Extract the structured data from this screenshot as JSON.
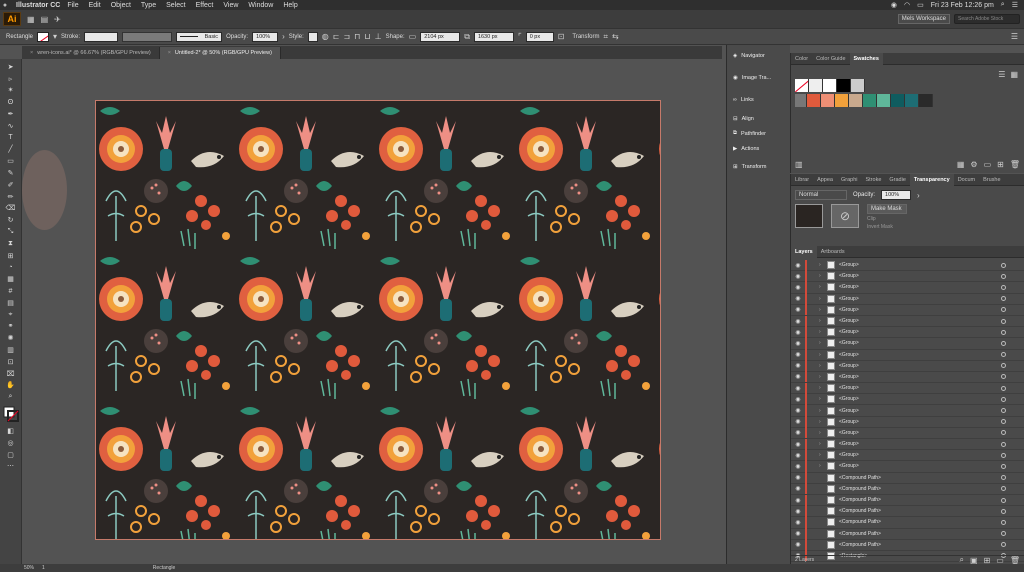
{
  "menubar": {
    "app_name": "Illustrator CC",
    "items": [
      "File",
      "Edit",
      "Object",
      "Type",
      "Select",
      "Effect",
      "View",
      "Window",
      "Help"
    ],
    "clock": "Fri 23 Feb 12:26 pm"
  },
  "appbar": {
    "logo": "Ai",
    "workspace": "Mels Workspace",
    "search_placeholder": "Search Adobe Stock"
  },
  "control": {
    "selection": "Rectangle",
    "stroke_label": "Stroke:",
    "brush_label": "Basic",
    "opacity_label": "Opacity:",
    "opacity_value": "100%",
    "style_label": "Style:",
    "shape_label": "Shape:",
    "width": "2104 px",
    "height": "1630 px",
    "corner": "0 px",
    "transform_label": "Transform"
  },
  "tabs": [
    {
      "label": "wren-icons.ai* @ 66.67% (RGB/GPU Preview)",
      "active": false
    },
    {
      "label": "Untitled-2* @ 50% (RGB/GPU Preview)",
      "active": true
    }
  ],
  "dock": {
    "items": [
      "Navigator",
      "Image Tra...",
      "Links",
      "Align",
      "Pathfinder",
      "Actions",
      "Transform"
    ]
  },
  "color_panel": {
    "tabs": [
      "Color",
      "Color Guide",
      "Swatches"
    ],
    "active_tab": "Swatches",
    "swatches": [
      "#ffffff",
      "#000000",
      "#e05a3c",
      "#ee8f75",
      "#f2a13b",
      "#c9a98d",
      "#2f8f73",
      "#5fb79a",
      "#0f5c5f",
      "#1d6d74",
      "#2a2a2a"
    ]
  },
  "transparency_panel": {
    "tabs": [
      "Librar",
      "Appea",
      "Graphi",
      "Stroke",
      "Gradie",
      "Transparency",
      "Docum",
      "Brushe"
    ],
    "active_tab": "Transparency",
    "blend_mode": "Normal",
    "opacity_label": "Opacity:",
    "opacity_value": "100%",
    "make_mask": "Make Mask",
    "clip": "Clip",
    "invert_mask": "Invert Mask"
  },
  "layers_panel": {
    "tabs": [
      "Layers",
      "Artboards"
    ],
    "active_tab": "Layers",
    "rows": [
      "<Group>",
      "<Group>",
      "<Group>",
      "<Group>",
      "<Group>",
      "<Group>",
      "<Group>",
      "<Group>",
      "<Group>",
      "<Group>",
      "<Group>",
      "<Group>",
      "<Group>",
      "<Group>",
      "<Group>",
      "<Group>",
      "<Group>",
      "<Group>",
      "<Group>",
      "<Compound Path>",
      "<Compound Path>",
      "<Compound Path>",
      "<Compound Path>",
      "<Compound Path>",
      "<Compound Path>",
      "<Compound Path>",
      "<Rectangle>"
    ],
    "footer": "2 Layers"
  },
  "status": {
    "zoom": "50%",
    "artboard": "1",
    "tool": "Rectangle"
  },
  "colors": {
    "accent": "#d34a3a",
    "artboard_border": "#c67a6a"
  }
}
